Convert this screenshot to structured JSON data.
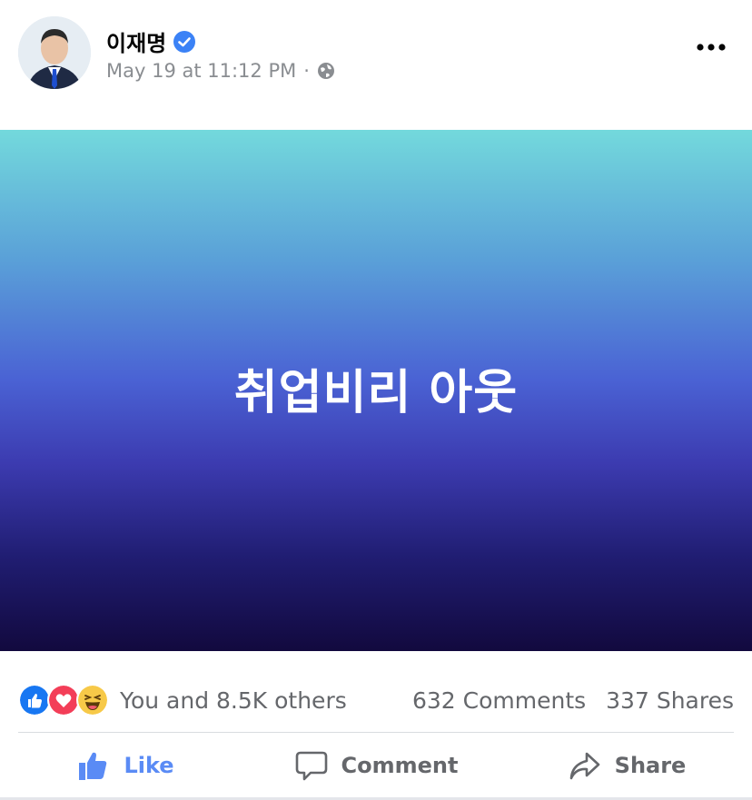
{
  "post": {
    "author": "이재명",
    "timestamp": "May 19 at 11:12 PM",
    "separator": "·",
    "privacy_icon": "globe-icon",
    "verified_icon": "verified-badge-icon",
    "more_icon": "more-options-icon",
    "image_text": "취업비리 아웃"
  },
  "stats": {
    "reactions": [
      "like",
      "love",
      "haha"
    ],
    "reactors": "You and 8.5K others",
    "comments": "632 Comments",
    "shares": "337 Shares"
  },
  "actions": {
    "like": "Like",
    "comment": "Comment",
    "share": "Share"
  },
  "colors": {
    "like_blue": "#5a8bf5",
    "verified_blue": "#3b82f6",
    "love_red": "#f33e58",
    "haha_yellow": "#f7c948",
    "text_secondary": "#65676b"
  }
}
